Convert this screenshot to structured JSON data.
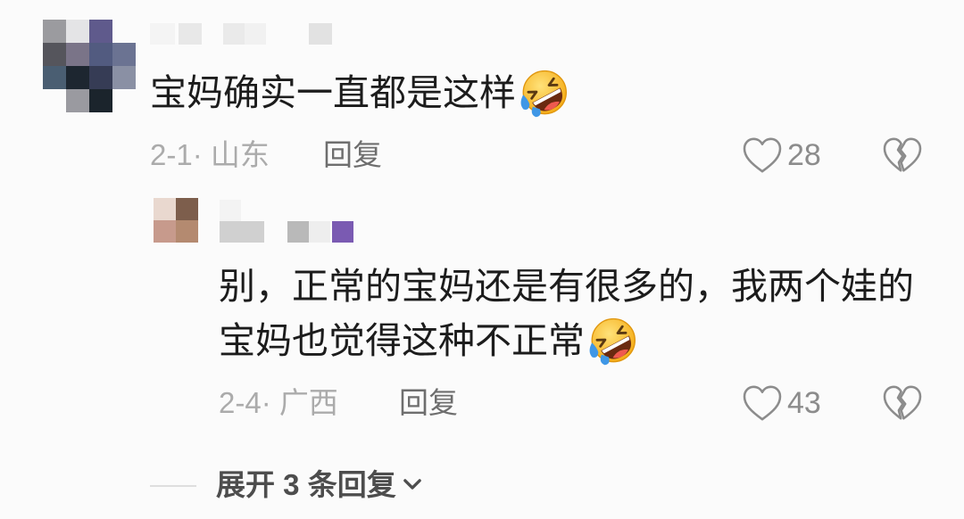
{
  "theme": {
    "bg": "#fbfbfb",
    "text": "#1c1c1c",
    "meta": "#ababab",
    "action": "#6e6e6e",
    "icon": "#8c8c8c",
    "expand": "#4d4d4d",
    "divider": "#dedede"
  },
  "comment": {
    "text": "宝妈确实一直都是这样",
    "emoji_icon": "rolling-on-the-floor-laughing-icon",
    "meta": "2-1· 山东",
    "reply_label": "回复",
    "like_icon": "heart-outline-icon",
    "like_count": "28",
    "dislike_icon": "broken-heart-icon"
  },
  "reply": {
    "text": "别，正常的宝妈还是有很多的，我两个娃的宝妈也觉得这种不正常",
    "emoji_icon": "rolling-on-the-floor-laughing-icon",
    "meta": "2-4· 广西",
    "reply_label": "回复",
    "like_icon": "heart-outline-icon",
    "like_count": "43",
    "dislike_icon": "broken-heart-icon"
  },
  "expand_replies": {
    "label": "展开 3 条回复",
    "icon": "chevron-down-icon"
  }
}
